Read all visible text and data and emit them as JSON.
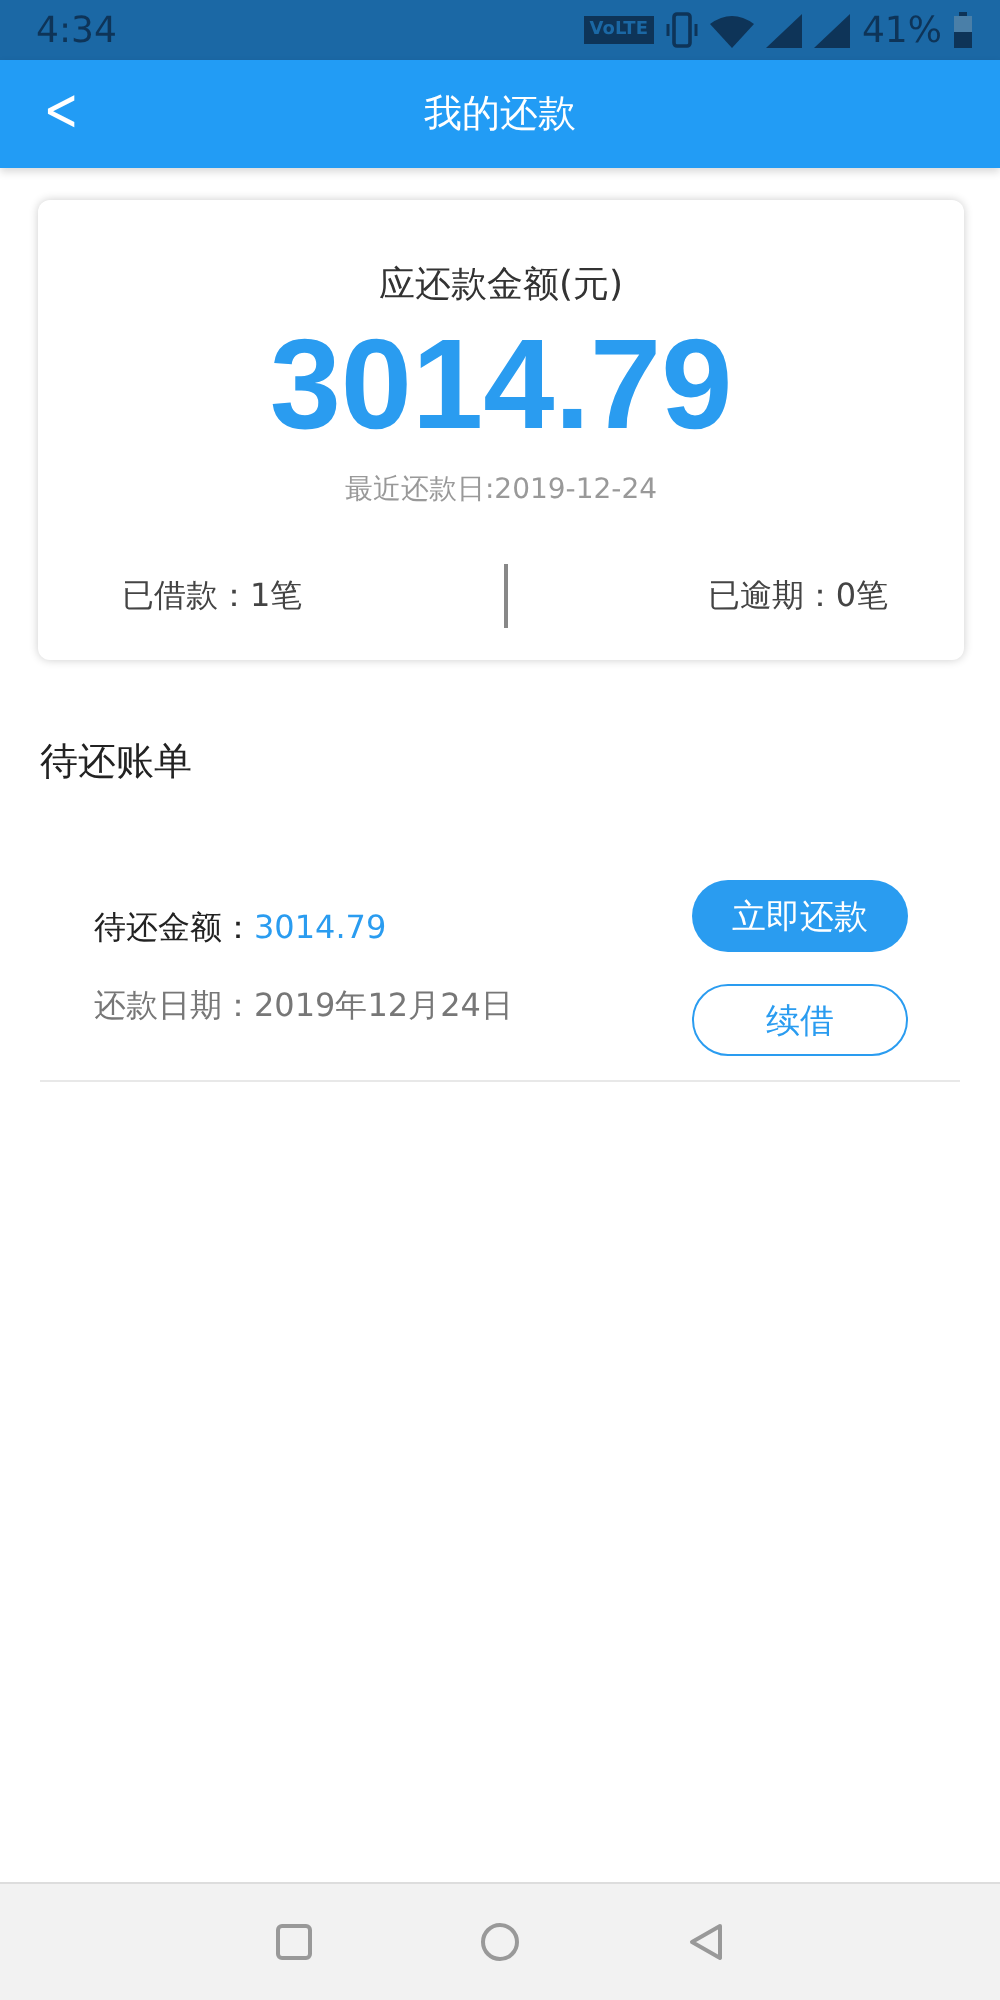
{
  "status_bar": {
    "time": "4:34",
    "network": "VoLTE",
    "battery": "41%"
  },
  "header": {
    "back": "<",
    "title": "我的还款"
  },
  "summary": {
    "label": "应还款金额(元)",
    "amount": "3014.79",
    "due": "最近还款日:2019-12-24",
    "borrowed": "已借款：1笔",
    "overdue": "已逾期：0笔"
  },
  "section_title": "待还账单",
  "bills": [
    {
      "amount_label": "待还金额：",
      "amount": "3014.79",
      "date_label": "还款日期：",
      "date": "2019年12月24日",
      "actions": [
        {
          "label": "立即还款",
          "kind": "primary"
        },
        {
          "label": "续借",
          "kind": "outline"
        }
      ]
    }
  ]
}
